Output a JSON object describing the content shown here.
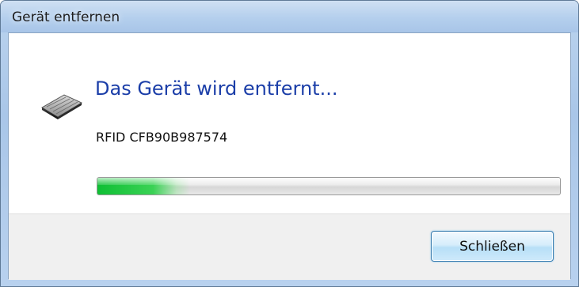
{
  "window": {
    "title": "Gerät entfernen"
  },
  "content": {
    "heading": "Das Gerät wird entfernt...",
    "device_name": "RFID CFB90B987574",
    "device_icon": "keyboard-device-icon",
    "progress_fraction": 0.2
  },
  "footer": {
    "close_label": "Schließen"
  },
  "colors": {
    "heading": "#1b3ea8",
    "progress": "#1fc63e",
    "titlebar": "#b4cfed"
  }
}
